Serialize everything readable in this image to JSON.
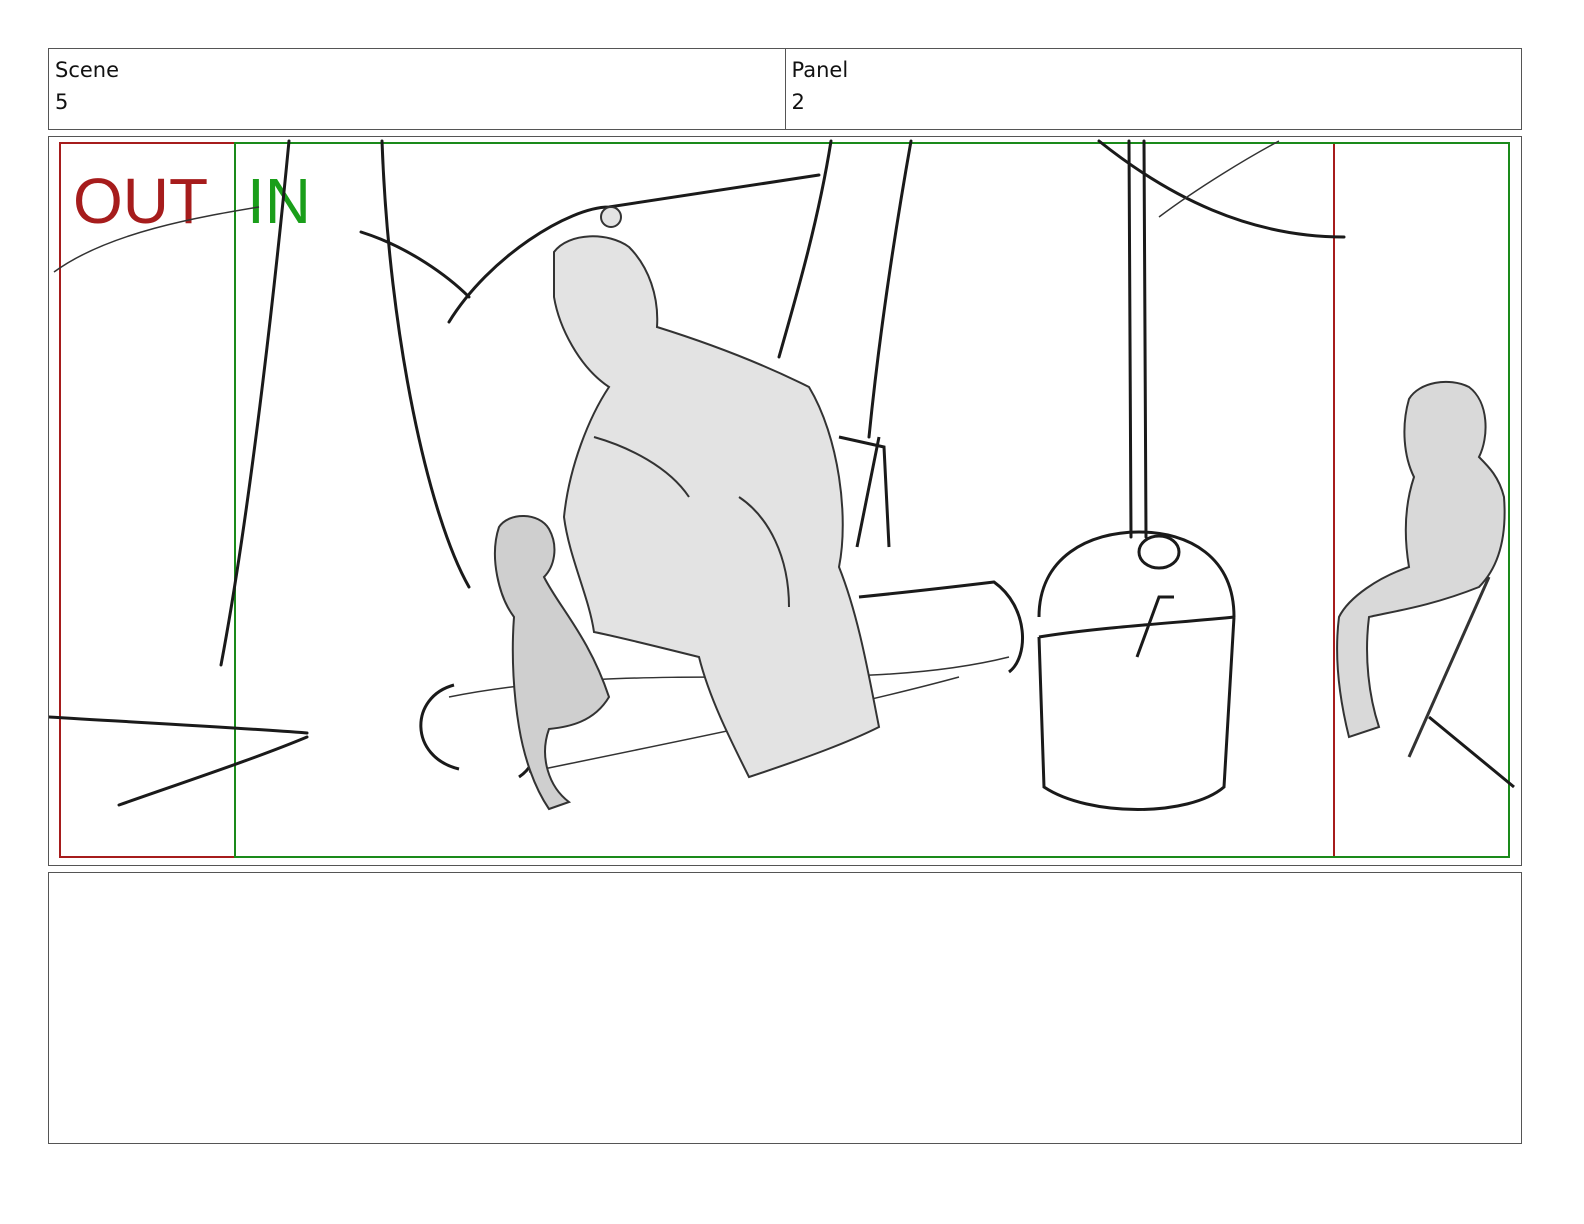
{
  "header": {
    "scene_label": "Scene",
    "scene_value": "5",
    "panel_label": "Panel",
    "panel_value": "2"
  },
  "frame": {
    "out_label": "OUT",
    "in_label": "IN",
    "out_color": "#a61c1c",
    "in_color": "#1a9e1a"
  },
  "notes": {
    "text": ""
  }
}
